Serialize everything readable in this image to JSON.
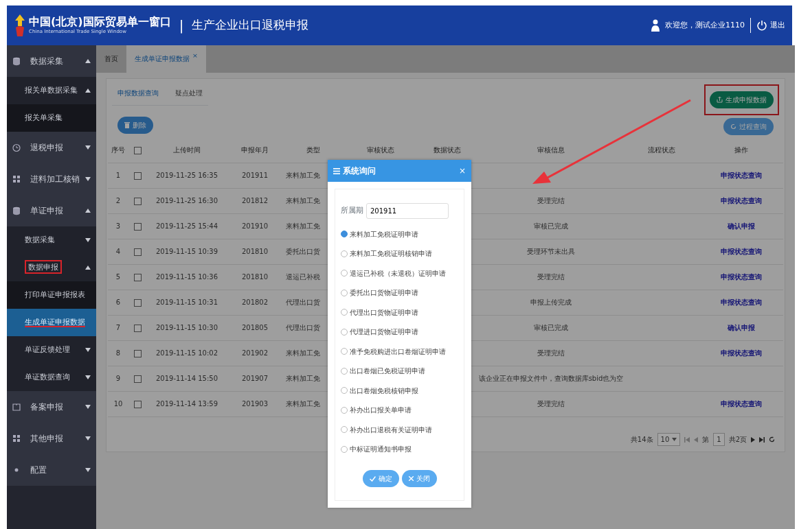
{
  "header": {
    "logo_title": "中国(北京)国际贸易单一窗口",
    "logo_subtitle": "China International Trade Single Window",
    "separator": "|",
    "app_title": "生产企业出口退税申报",
    "welcome": "欢迎您，测试企业1110",
    "logout": "退出"
  },
  "sidebar": {
    "items": [
      {
        "label": "数据采集",
        "expanded": true,
        "selected": false,
        "children": [
          {
            "label": "报关单数据采集",
            "expanded": true,
            "selected": false,
            "children": [
              {
                "label": "报关单采集",
                "selected": false
              }
            ]
          }
        ]
      },
      {
        "label": "退税申报",
        "expanded": false,
        "selected": false
      },
      {
        "label": "进料加工核销",
        "expanded": false,
        "selected": false
      },
      {
        "label": "单证申报",
        "expanded": true,
        "selected": false,
        "children": [
          {
            "label": "数据采集",
            "expanded": false,
            "selected": false
          },
          {
            "label": "数据申报",
            "expanded": true,
            "selected": false,
            "boxed": true,
            "children": [
              {
                "label": "打印单证申报报表",
                "selected": false
              },
              {
                "label": "生成单证申报数据",
                "selected": true,
                "underlined": true
              }
            ]
          },
          {
            "label": "单证反馈处理",
            "expanded": false,
            "selected": false
          },
          {
            "label": "单证数据查询",
            "expanded": false,
            "selected": false
          }
        ]
      },
      {
        "label": "备案申报",
        "expanded": false,
        "selected": false
      },
      {
        "label": "其他申报",
        "expanded": false,
        "selected": false
      },
      {
        "label": "配置",
        "expanded": false,
        "selected": false
      }
    ]
  },
  "tabs": [
    {
      "label": "首页",
      "selected": false
    },
    {
      "label": "生成单证申报数据",
      "selected": true,
      "close": "×"
    }
  ],
  "subtabs": [
    {
      "label": "申报数据查询",
      "selected": true
    },
    {
      "label": "疑点处理",
      "selected": false
    }
  ],
  "delete_button": "删除",
  "side_buttons": [
    {
      "label": "生成申报数据",
      "kind": "generate",
      "boxed": true
    },
    {
      "label": "过程查询",
      "kind": "query"
    }
  ],
  "table": {
    "header_checked": false,
    "columns": [
      "序号",
      "上传时间",
      "申报年月",
      "类型",
      "审核状态",
      "数据状态",
      "审核信息",
      "流程状态",
      "操作"
    ],
    "rows": [
      {
        "index": "1",
        "checked": false,
        "uploaded": "2019-11-25 16:35",
        "period": "201911",
        "type": "来料加工免",
        "operation": "申报状态查询"
      },
      {
        "index": "2",
        "checked": false,
        "uploaded": "2019-11-25 16:30",
        "period": "201812",
        "type": "来料加工免",
        "audit_info": "受理完结",
        "operation": "申报状态查询"
      },
      {
        "index": "3",
        "checked": false,
        "uploaded": "2019-11-25 15:44",
        "period": "201910",
        "type": "来料加工免",
        "audit_info": "审核已完成",
        "operation": "确认申报"
      },
      {
        "index": "4",
        "checked": false,
        "uploaded": "2019-11-15 10:39",
        "period": "201810",
        "type": "委托出口货",
        "audit_info": "受理环节未出具",
        "operation": "申报状态查询"
      },
      {
        "index": "5",
        "checked": false,
        "uploaded": "2019-11-15 10:36",
        "period": "201810",
        "type": "退运已补税",
        "audit_info": "受理完结",
        "operation": "申报状态查询"
      },
      {
        "index": "6",
        "checked": false,
        "uploaded": "2019-11-15 10:31",
        "period": "201802",
        "type": "代理出口货",
        "audit_info": "申报上传完成",
        "operation": "申报状态查询"
      },
      {
        "index": "7",
        "checked": false,
        "uploaded": "2019-11-15 10:30",
        "period": "201805",
        "type": "代理出口货",
        "audit_info": "审核已完成",
        "operation": "确认申报"
      },
      {
        "index": "8",
        "checked": false,
        "uploaded": "2019-11-15 10:02",
        "period": "201902",
        "type": "来料加工免",
        "audit_info": "受理完结",
        "operation": "申报状态查询"
      },
      {
        "index": "9",
        "checked": false,
        "uploaded": "2019-11-14 15:50",
        "period": "201907",
        "type": "来料加工免",
        "audit_info": "该企业正在申报文件中，查询数据库sbid也为空"
      },
      {
        "index": "10",
        "checked": false,
        "uploaded": "2019-11-14 13:59",
        "period": "201903",
        "type": "来料加工免",
        "audit_info": "受理完结",
        "operation": "申报状态查询"
      }
    ]
  },
  "pagination": {
    "total": "共14条",
    "page_size": "10",
    "page_label": "第",
    "page": "1",
    "pages": "共2页"
  },
  "dialog": {
    "title": "系统询问",
    "close": "×",
    "field_label": "所属期",
    "field_value": "201911",
    "options": [
      {
        "label": "来料加工免税证明申请",
        "selected": true
      },
      {
        "label": "来料加工免税证明核销申请",
        "selected": false
      },
      {
        "label": "退运已补税（未退税）证明申请",
        "selected": false
      },
      {
        "label": "委托出口货物证明申请",
        "selected": false
      },
      {
        "label": "代理出口货物证明申请",
        "selected": false
      },
      {
        "label": "代理进口货物证明申请",
        "selected": false
      },
      {
        "label": "准予免税购进出口卷烟证明申请",
        "selected": false
      },
      {
        "label": "出口卷烟已免税证明申请",
        "selected": false
      },
      {
        "label": "出口卷烟免税核销申报",
        "selected": false
      },
      {
        "label": "补办出口报关单申请",
        "selected": false
      },
      {
        "label": "补办出口退税有关证明申请",
        "selected": false
      },
      {
        "label": "中标证明通知书申报",
        "selected": false
      }
    ],
    "buttons": [
      {
        "label": "确定",
        "kind": "ok"
      },
      {
        "label": "关闭",
        "kind": "cancel"
      }
    ]
  },
  "annotation_arrow": true
}
